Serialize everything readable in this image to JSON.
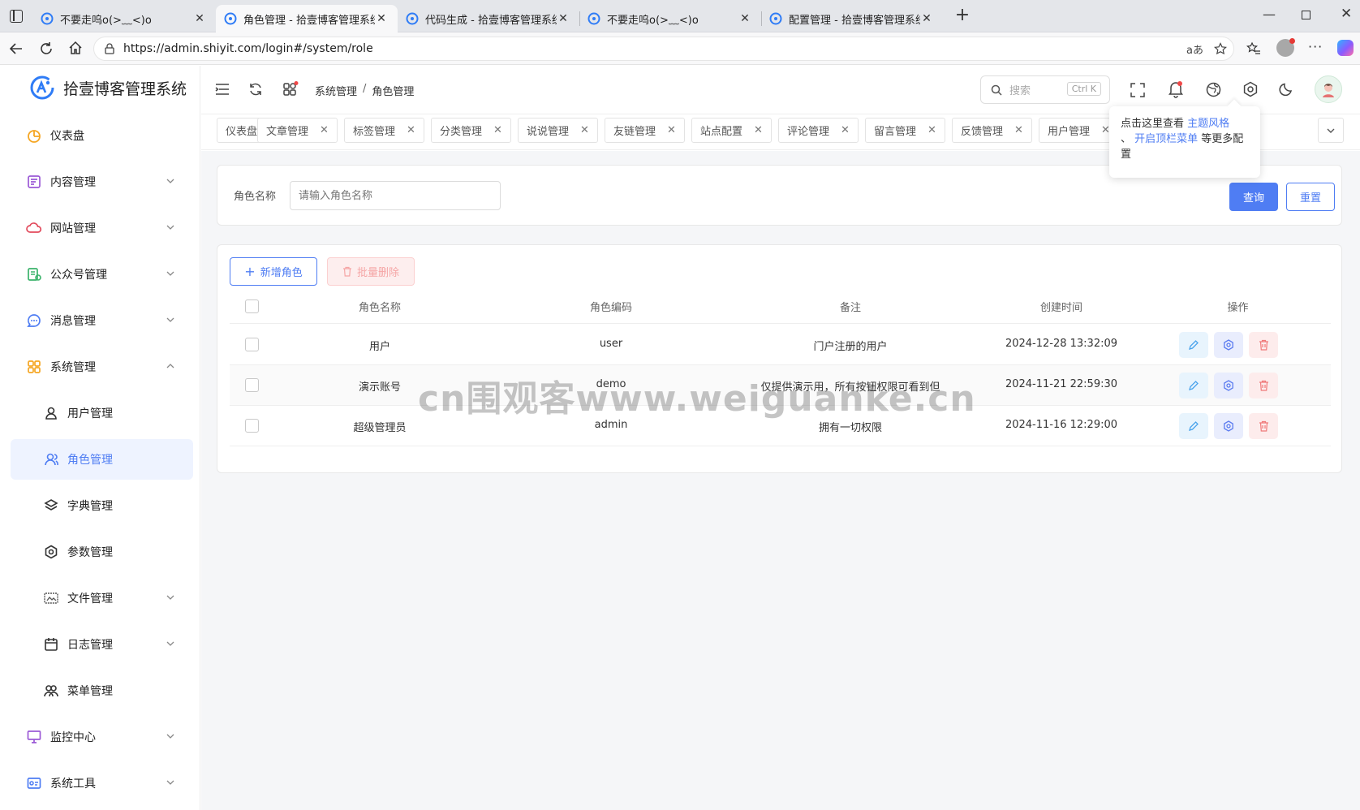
{
  "browser": {
    "tabs": [
      {
        "title": "不要走呜o(>﹏<)o",
        "active": false
      },
      {
        "title": "角色管理 - 拾壹博客管理系统",
        "active": true
      },
      {
        "title": "代码生成 - 拾壹博客管理系统",
        "active": false
      },
      {
        "title": "不要走呜o(>﹏<)o",
        "active": false
      },
      {
        "title": "配置管理 - 拾壹博客管理系统",
        "active": false
      }
    ],
    "url": "https://admin.shiyit.com/login#/system/role"
  },
  "app": {
    "name": "拾壹博客管理系统",
    "accent": "#4f7df3"
  },
  "sidebar": {
    "items": [
      {
        "label": "仪表盘",
        "icon": "dashboard-icon",
        "color": "#f5a623"
      },
      {
        "label": "内容管理",
        "icon": "content-icon",
        "color": "#9b59d6"
      },
      {
        "label": "网站管理",
        "icon": "cloud-icon",
        "color": "#e24a5c"
      },
      {
        "label": "公众号管理",
        "icon": "wechat-official-icon",
        "color": "#3bb36b"
      },
      {
        "label": "消息管理",
        "icon": "message-icon",
        "color": "#4f7df3"
      },
      {
        "label": "系统管理",
        "icon": "system-icon",
        "color": "#f5a623"
      },
      {
        "label": "用户管理",
        "icon": "user-icon"
      },
      {
        "label": "角色管理",
        "icon": "role-icon"
      },
      {
        "label": "字典管理",
        "icon": "dictionary-icon"
      },
      {
        "label": "参数管理",
        "icon": "parameter-icon"
      },
      {
        "label": "文件管理",
        "icon": "file-icon"
      },
      {
        "label": "日志管理",
        "icon": "log-icon"
      },
      {
        "label": "菜单管理",
        "icon": "menu-icon"
      },
      {
        "label": "监控中心",
        "icon": "monitor-icon",
        "color": "#9b59d6"
      },
      {
        "label": "系统工具",
        "icon": "tools-icon",
        "color": "#4f7df3"
      }
    ]
  },
  "header": {
    "breadcrumb": [
      "系统管理",
      "角色管理"
    ],
    "breadcrumb_sep": "/",
    "search_placeholder": "搜索",
    "search_shortcut": "Ctrl K"
  },
  "tags": [
    {
      "label": "仪表盘",
      "closable": false
    },
    {
      "label": "文章管理",
      "closable": true
    },
    {
      "label": "标签管理",
      "closable": true
    },
    {
      "label": "分类管理",
      "closable": true
    },
    {
      "label": "说说管理",
      "closable": true
    },
    {
      "label": "友链管理",
      "closable": true
    },
    {
      "label": "站点配置",
      "closable": true
    },
    {
      "label": "评论管理",
      "closable": true
    },
    {
      "label": "留言管理",
      "closable": true
    },
    {
      "label": "反馈管理",
      "closable": true
    },
    {
      "label": "用户管理",
      "closable": true
    }
  ],
  "tooltip": {
    "prefix": "点击这里查看 ",
    "link1": "主题风格",
    "middle": "、 ",
    "link2": "开启顶栏菜单",
    "suffix": " 等更多配置"
  },
  "search_form": {
    "label": "角色名称",
    "placeholder": "请输入角色名称",
    "query_button": "查询",
    "reset_button": "重置"
  },
  "toolbar": {
    "add_button": "新增角色",
    "batch_delete_button": "批量删除"
  },
  "table": {
    "columns": [
      "角色名称",
      "角色编码",
      "备注",
      "创建时间",
      "操作"
    ],
    "rows": [
      {
        "name": "用户",
        "code": "user",
        "remark": "门户注册的用户",
        "created": "2024-12-28 13:32:09"
      },
      {
        "name": "演示账号",
        "code": "demo",
        "remark": "仅提供演示用，所有按钮权限可看到但",
        "created": "2024-11-21 22:59:30"
      },
      {
        "name": "超级管理员",
        "code": "admin",
        "remark": "拥有一切权限",
        "created": "2024-11-16 12:29:00"
      }
    ]
  },
  "watermark": "cn围观客www.weiguanke.cn"
}
